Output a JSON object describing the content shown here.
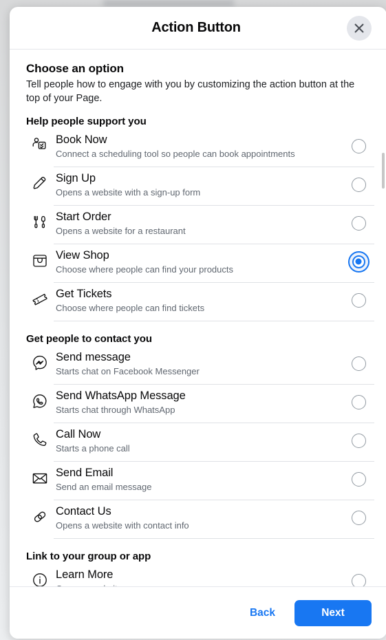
{
  "dialog": {
    "title": "Action Button",
    "close_icon": "close-icon"
  },
  "intro": {
    "heading": "Choose an option",
    "description": "Tell people how to engage with you by customizing the action button at the top of your Page."
  },
  "sections": [
    {
      "title": "Help people support you",
      "options": [
        {
          "icon": "book-appointment-icon",
          "label": "Book Now",
          "desc": "Connect a scheduling tool so people can book appointments",
          "selected": false
        },
        {
          "icon": "pencil-icon",
          "label": "Sign Up",
          "desc": "Opens a website with a sign-up form",
          "selected": false
        },
        {
          "icon": "fork-knife-icon",
          "label": "Start Order",
          "desc": "Opens a website for a restaurant",
          "selected": false
        },
        {
          "icon": "shopping-bag-icon",
          "label": "View Shop",
          "desc": "Choose where people can find your products",
          "selected": true
        },
        {
          "icon": "ticket-icon",
          "label": "Get Tickets",
          "desc": "Choose where people can find tickets",
          "selected": false
        }
      ]
    },
    {
      "title": "Get people to contact you",
      "options": [
        {
          "icon": "messenger-icon",
          "label": "Send message",
          "desc": "Starts chat on Facebook Messenger",
          "selected": false
        },
        {
          "icon": "whatsapp-icon",
          "label": "Send WhatsApp Message",
          "desc": "Starts chat through WhatsApp",
          "selected": false
        },
        {
          "icon": "phone-icon",
          "label": "Call Now",
          "desc": "Starts a phone call",
          "selected": false
        },
        {
          "icon": "envelope-icon",
          "label": "Send Email",
          "desc": "Send an email message",
          "selected": false
        },
        {
          "icon": "link-icon",
          "label": "Contact Us",
          "desc": "Opens a website with contact info",
          "selected": false
        }
      ]
    },
    {
      "title": "Link to your group or app",
      "options": [
        {
          "icon": "info-circle-icon",
          "label": "Learn More",
          "desc": "Opens a website",
          "selected": false
        }
      ]
    }
  ],
  "footer": {
    "back_label": "Back",
    "next_label": "Next"
  },
  "colors": {
    "accent": "#1877f2",
    "text_primary": "#080809",
    "text_secondary": "#606770",
    "divider": "#dfe1e5",
    "close_bg": "#e4e6eb"
  }
}
